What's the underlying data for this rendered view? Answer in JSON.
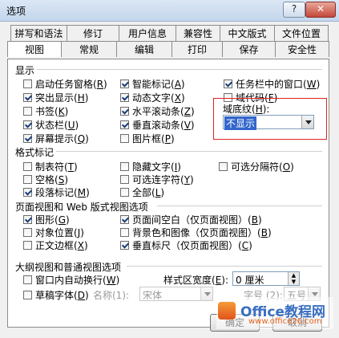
{
  "window": {
    "title": "选项",
    "help_label": "?",
    "close_label": "✕"
  },
  "tabs_row1": [
    {
      "label": "拼写和语法"
    },
    {
      "label": "修订"
    },
    {
      "label": "用户信息"
    },
    {
      "label": "兼容性"
    },
    {
      "label": "中文版式"
    },
    {
      "label": "文件位置"
    }
  ],
  "tabs_row2": [
    {
      "label": "视图",
      "active": true
    },
    {
      "label": "常规"
    },
    {
      "label": "编辑"
    },
    {
      "label": "打印"
    },
    {
      "label": "保存"
    },
    {
      "label": "安全性"
    }
  ],
  "display": {
    "section_title": "显示",
    "options": [
      {
        "label": "启动任务窗格",
        "key": "R",
        "checked": false
      },
      {
        "label": "智能标记",
        "key": "A",
        "checked": true
      },
      {
        "label": "任务栏中的窗口",
        "key": "W",
        "checked": true
      },
      {
        "label": "突出显示",
        "key": "H",
        "checked": true
      },
      {
        "label": "动态文字",
        "key": "X",
        "checked": true
      },
      {
        "label": "域代码",
        "key": "F",
        "checked": false
      },
      {
        "label": "书签",
        "key": "K",
        "checked": false
      },
      {
        "label": "水平滚动条",
        "key": "Z",
        "checked": true
      },
      {
        "label": "状态栏",
        "key": "U",
        "checked": true
      },
      {
        "label": "垂直滚动条",
        "key": "V",
        "checked": true
      },
      {
        "label": "屏幕提示",
        "key": "Q",
        "checked": true
      },
      {
        "label": "图片框",
        "key": "P",
        "checked": false
      }
    ],
    "field_shading_label": "域底纹",
    "field_shading_key": "H",
    "field_shading_value": "不显示"
  },
  "format_marks": {
    "section_title": "格式标记",
    "options": [
      {
        "label": "制表符",
        "key": "T",
        "checked": false
      },
      {
        "label": "隐藏文字",
        "key": "I",
        "checked": false
      },
      {
        "label": "可选分隔符",
        "key": "O",
        "checked": false
      },
      {
        "label": "空格",
        "key": "S",
        "checked": false
      },
      {
        "label": "可选连字符",
        "key": "Y",
        "checked": false
      },
      {
        "label": "段落标记",
        "key": "M",
        "checked": true
      },
      {
        "label": "全部",
        "key": "L",
        "checked": false
      }
    ]
  },
  "print_web": {
    "section_title": "页面视图和 Web 版式视图选项",
    "options": [
      {
        "label": "图形",
        "key": "G",
        "checked": true
      },
      {
        "label": "页面间空白（仅页面视图）",
        "key": "B",
        "checked": true
      },
      {
        "label": "对象位置",
        "key": "J",
        "checked": false
      },
      {
        "label": "背景色和图像（仅页面视图）",
        "key": "B",
        "checked": false
      },
      {
        "label": "正文边框",
        "key": "X",
        "checked": false
      },
      {
        "label": "垂直标尺（仅页面视图）",
        "key": "C",
        "checked": true
      }
    ]
  },
  "outline": {
    "section_title": "大纲视图和普通视图选项",
    "wrap_label": "窗口内自动换行",
    "wrap_key": "W",
    "wrap_checked": false,
    "draft_label": "草稿字体",
    "draft_key": "D",
    "draft_checked": false,
    "style_width_label": "样式区宽度",
    "style_width_key": "E",
    "style_width_value": "0 厘米",
    "name_label": "名称(1):",
    "name_value": "宋体",
    "size_label": "字号 (2):",
    "size_value": "五号"
  },
  "buttons": {
    "ok": "确定",
    "cancel": "取消"
  },
  "watermark": {
    "brand": "Office教程网",
    "url": "www.office26.com"
  }
}
